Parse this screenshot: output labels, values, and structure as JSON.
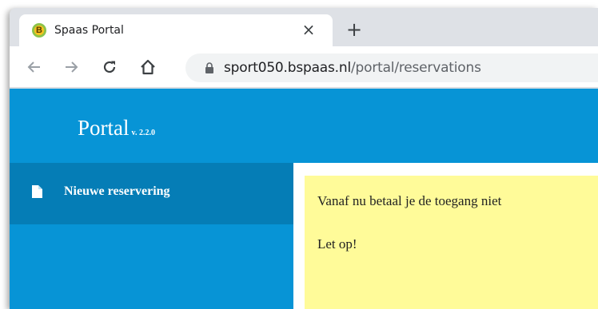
{
  "browser": {
    "tab": {
      "title": "Spaas Portal",
      "favicon_letter": "B",
      "close_glyph": "×"
    },
    "new_tab_glyph": "+",
    "address_bar": {
      "host": "sport050.bspaas.nl",
      "path": "/portal/reservations"
    },
    "icons": [
      "back-arrow-icon",
      "forward-arrow-icon",
      "reload-icon",
      "home-icon",
      "lock-icon"
    ]
  },
  "header": {
    "title": "Portal",
    "version": "v. 2.2.0"
  },
  "sidebar": {
    "items": [
      {
        "label": "Nieuwe reservering",
        "icon": "document-icon"
      }
    ]
  },
  "notice": {
    "line1": "Vanaf nu betaal je de toegang niet",
    "line2": "Let op!"
  },
  "colors": {
    "primary": "#0794d6",
    "sidebar_active": "#057db6",
    "notice_bg": "#fffb99"
  }
}
